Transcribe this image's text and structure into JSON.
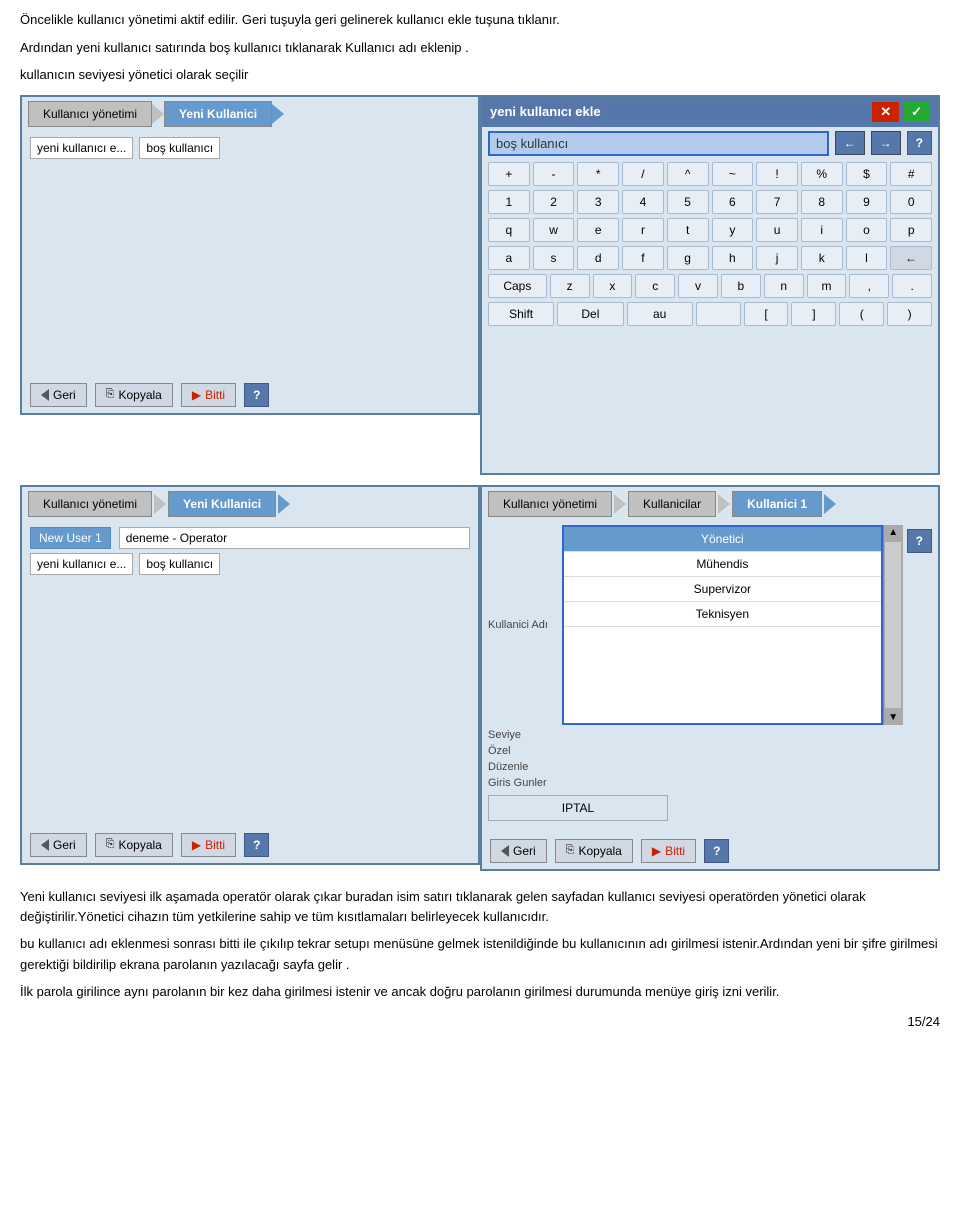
{
  "instructions": {
    "line1": "Öncelikle kullanıcı yönetimi aktif edilir.",
    "line2": "Geri tuşuyla geri gelinerek kullanıcı ekle tuşuna tıklanır.",
    "line3": "Ardından yeni kullanıcı satırında boş kullanıcı tıklanarak  Kullanıcı  adı eklenip .",
    "line4": "kullanıcın seviyesi yönetici olarak seçilir"
  },
  "panel1": {
    "tab1": "Kullanıcı yönetimi",
    "tab2": "Yeni Kullanici",
    "input1_placeholder": "yeni kullanıcı e...",
    "input2_placeholder": "boş kullanıcı",
    "btn_geri": "Geri",
    "btn_kopyala": "Kopyala",
    "btn_bitti": "Bitti",
    "btn_q": "?"
  },
  "keyboard": {
    "title": "yeni kullanıcı ekle",
    "input_value": "boş kullanıcı",
    "rows": [
      [
        "+",
        "-",
        "*",
        "/",
        "^",
        "~",
        "!",
        "%",
        "$",
        "#"
      ],
      [
        "1",
        "2",
        "3",
        "4",
        "5",
        "6",
        "7",
        "8",
        "9",
        "0"
      ],
      [
        "q",
        "w",
        "e",
        "r",
        "t",
        "y",
        "u",
        "i",
        "o",
        "p"
      ],
      [
        "a",
        "s",
        "d",
        "f",
        "g",
        "h",
        "j",
        "k",
        "l",
        "←"
      ],
      [
        "Caps",
        "z",
        "x",
        "c",
        "v",
        "b",
        "n",
        "m",
        ",",
        "."
      ],
      [
        "Shift",
        "Del",
        "au",
        "",
        "[",
        "]",
        "(",
        ")"
      ]
    ]
  },
  "panel2": {
    "tab1": "Kullanıcı yönetimi",
    "tab2": "Yeni Kullanici",
    "user1": "New User 1",
    "user2": "deneme   - Operator",
    "input1_placeholder": "yeni kullanıcı e...",
    "input2_placeholder": "boş kullanıcı",
    "btn_geri": "Geri",
    "btn_kopyala": "Kopyala",
    "btn_bitti": "Bitti",
    "btn_q": "?"
  },
  "panel3": {
    "tab1": "Kullanıcı yönetimi",
    "tab2": "Kullanicilar",
    "tab3": "Kullanici 1",
    "label_name": "Kullanici Adı",
    "label_level": "Seviye",
    "label_ozel": "Özel",
    "label_duzenle": "Düzenle",
    "label_giris": "Giris Gunler",
    "levels": [
      "Yönetici",
      "Mühendis",
      "Supervizor",
      "Teknisyen"
    ],
    "btn_iptal": "IPTAL",
    "btn_geri": "Geri",
    "btn_kopyala": "Kopyala",
    "btn_bitti": "Bitti",
    "btn_q": "?"
  },
  "description": {
    "para1": "Yeni kullanıcı seviyesi  ilk aşamada operatör olarak çıkar buradan  isim satırı tıklanarak gelen sayfadan kullanıcı seviyesi operatörden yönetici olarak değiştirilir.Yönetici cihazın tüm yetkilerine sahip ve tüm kısıtlamaları belirleyecek kullanıcıdır.",
    "para2": "bu kullanıcı adı eklenmesi sonrası bitti ile çıkılıp tekrar setupı menüsüne gelmek istenildiğinde bu kullanıcının adı girilmesi istenir.Ardından yeni bir şifre girilmesi gerektiği bildirilip ekrana parolanın yazılacağı sayfa gelir .",
    "para3": "İlk parola girilince aynı parolanın bir kez daha girilmesi istenir ve ancak doğru parolanın girilmesi durumunda menüye giriş izni verilir."
  },
  "page": "15/24"
}
